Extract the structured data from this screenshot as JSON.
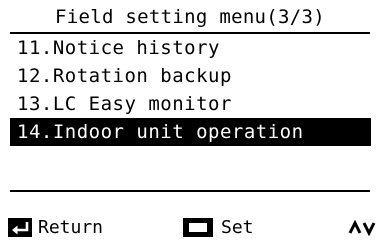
{
  "header": {
    "title": "Field setting menu(3/3)"
  },
  "menu": {
    "items": [
      {
        "label": "11.Notice history",
        "selected": false
      },
      {
        "label": "12.Rotation backup",
        "selected": false
      },
      {
        "label": "13.LC Easy monitor",
        "selected": false
      },
      {
        "label": "14.Indoor unit operation",
        "selected": true
      }
    ]
  },
  "footer": {
    "return_label": "Return",
    "return_icon": "return-arrow-icon",
    "set_label": "Set",
    "set_icon": "set-square-icon",
    "updown_icon": "up-down-chevron-icon"
  },
  "colors": {
    "background": "#ffffff",
    "foreground": "#000000",
    "highlight": "#000000",
    "highlight_text": "#ffffff"
  }
}
